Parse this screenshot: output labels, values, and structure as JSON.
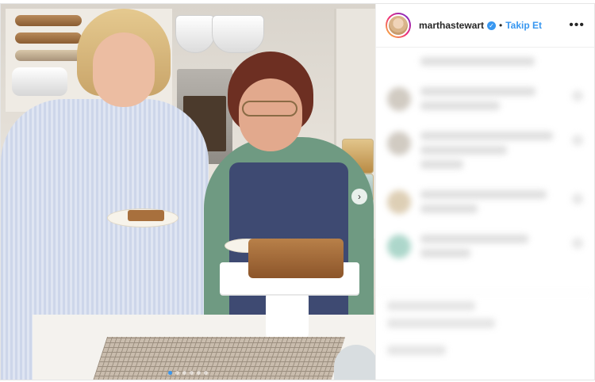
{
  "post": {
    "image_alt": "",
    "carousel": {
      "total": 6,
      "active_index": 0,
      "next_glyph": "›"
    }
  },
  "side": {
    "username": "marthastewart",
    "verified_glyph": "✓",
    "separator": "•",
    "follow_label": "Takip Et",
    "more_glyph": "•••"
  },
  "colors": {
    "link_blue": "#3897f0",
    "text_dark": "#262626"
  },
  "icons": {
    "verified": "verified-badge-icon",
    "more": "more-options-icon",
    "next": "chevron-right-icon"
  }
}
